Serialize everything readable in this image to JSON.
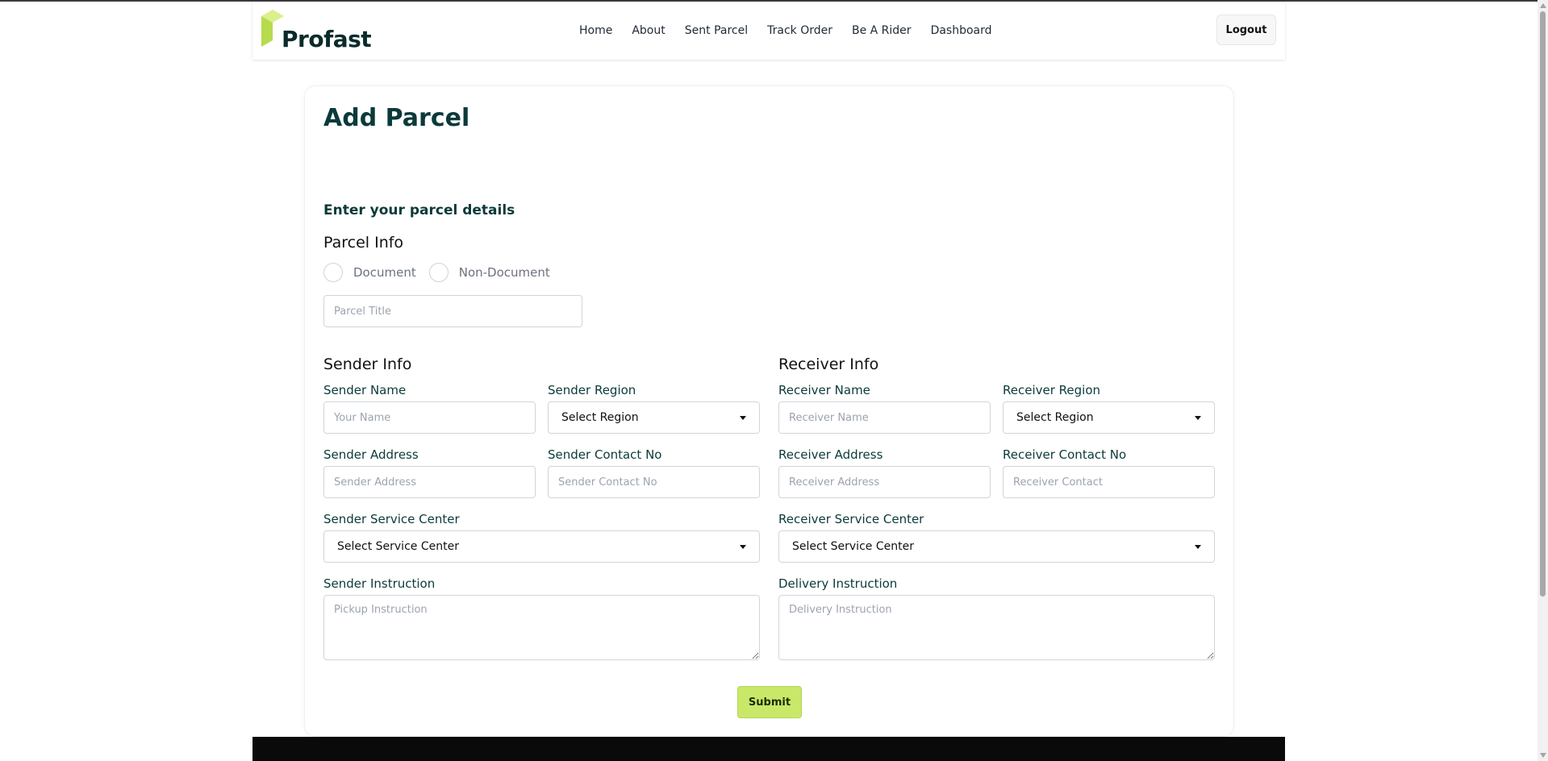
{
  "brand": {
    "name": "Profast",
    "accent": "#caeb66",
    "dark": "#0b3a3a"
  },
  "nav": {
    "links": [
      "Home",
      "About",
      "Sent Parcel",
      "Track Order",
      "Be A Rider",
      "Dashboard"
    ],
    "logout_label": "Logout"
  },
  "form": {
    "title": "Add Parcel",
    "subtitle": "Enter your parcel details",
    "parcel_info": {
      "heading": "Parcel Info",
      "type_options": [
        "Document",
        "Non-Document"
      ],
      "title_placeholder": "Parcel Title"
    },
    "sender": {
      "heading": "Sender Info",
      "name_label": "Sender Name",
      "name_placeholder": "Your Name",
      "region_label": "Sender Region",
      "region_value": "Select Region",
      "address_label": "Sender Address",
      "address_placeholder": "Sender Address",
      "contact_label": "Sender Contact No",
      "contact_placeholder": "Sender Contact No",
      "service_center_label": "Sender Service Center",
      "service_center_value": "Select Service Center",
      "instruction_label": "Sender Instruction",
      "instruction_placeholder": "Pickup Instruction"
    },
    "receiver": {
      "heading": "Receiver Info",
      "name_label": "Receiver Name",
      "name_placeholder": "Receiver Name",
      "region_label": "Receiver Region",
      "region_value": "Select Region",
      "address_label": "Receiver Address",
      "address_placeholder": "Receiver Address",
      "contact_label": "Receiver Contact No",
      "contact_placeholder": "Receiver Contact",
      "service_center_label": "Receiver Service Center",
      "service_center_value": "Select Service Center",
      "instruction_label": "Delivery Instruction",
      "instruction_placeholder": "Delivery Instruction"
    },
    "submit_label": "Submit"
  }
}
